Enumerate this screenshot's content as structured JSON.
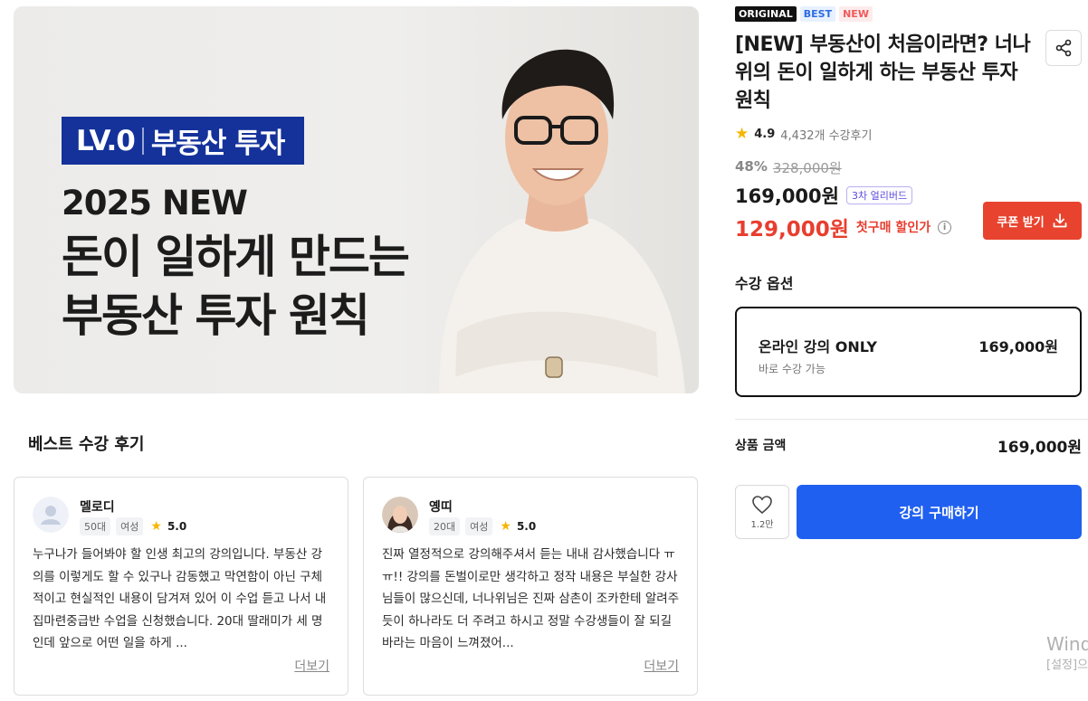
{
  "hero": {
    "badge_level": "LV.0",
    "badge_topic": "부동산 투자",
    "year_line": "2025 NEW",
    "headline_1": "돈이 일하게 만드는",
    "headline_2": "부동산 투자 원칙"
  },
  "reviews": {
    "section_title": "베스트 수강 후기",
    "items": [
      {
        "name": "멜로디",
        "age": "50대",
        "gender": "여성",
        "score": "5.0",
        "body": "누구나가 들어봐야 할 인생 최고의 강의입니다. 부동산 강의를 이렇게도 할 수 있구나 감동했고 막연함이 아닌 구체적이고 현실적인 내용이 담겨져 있어 이 수업 듣고 나서 내집마련중급반 수업을 신청했습니다. 20대 딸래미가 세 명인데 앞으로 어떤 일을 하게 ...",
        "more": "더보기"
      },
      {
        "name": "옝띠",
        "age": "20대",
        "gender": "여성",
        "score": "5.0",
        "body": "진짜 열정적으로 강의해주셔서 듣는 내내 감사했습니다 ㅠㅠ!! 강의를 돈벌이로만 생각하고 정작 내용은 부실한 강사님들이 많으신데, 너나위님은 진짜 삼촌이 조카한테 알려주듯이 하나라도 더 주려고 하시고 정말 수강생들이 잘 되길 바라는 마음이 느껴졌어...",
        "more": "더보기"
      }
    ]
  },
  "product": {
    "badges": [
      "ORIGINAL",
      "BEST",
      "NEW"
    ],
    "title": "[NEW] 부동산이 처음이라면? 너나위의 돈이 일하게 하는 부동산 투자 원칙",
    "rating": "4.9",
    "review_count": "4,432개 수강후기",
    "discount_pct": "48%",
    "original_price": "328,000원",
    "price": "169,000원",
    "early_bird": "3차 얼리버드",
    "first_price": "129,000원",
    "first_label": "첫구매 할인가",
    "coupon_label": "쿠폰 받기"
  },
  "options": {
    "title": "수강 옵션",
    "selected": {
      "name": "온라인 강의 ONLY",
      "price": "169,000원",
      "sub": "바로 수강 가능"
    }
  },
  "total": {
    "label": "상품 금액",
    "price": "169,000원"
  },
  "actions": {
    "like_count": "1.2만",
    "buy_label": "강의 구매하기"
  },
  "watermark": {
    "line1": "Wind",
    "line2": "[설정]으"
  },
  "colors": {
    "accent_blue": "#2060f0",
    "sale_red": "#e83e2f",
    "badge_navy": "#14329a"
  }
}
